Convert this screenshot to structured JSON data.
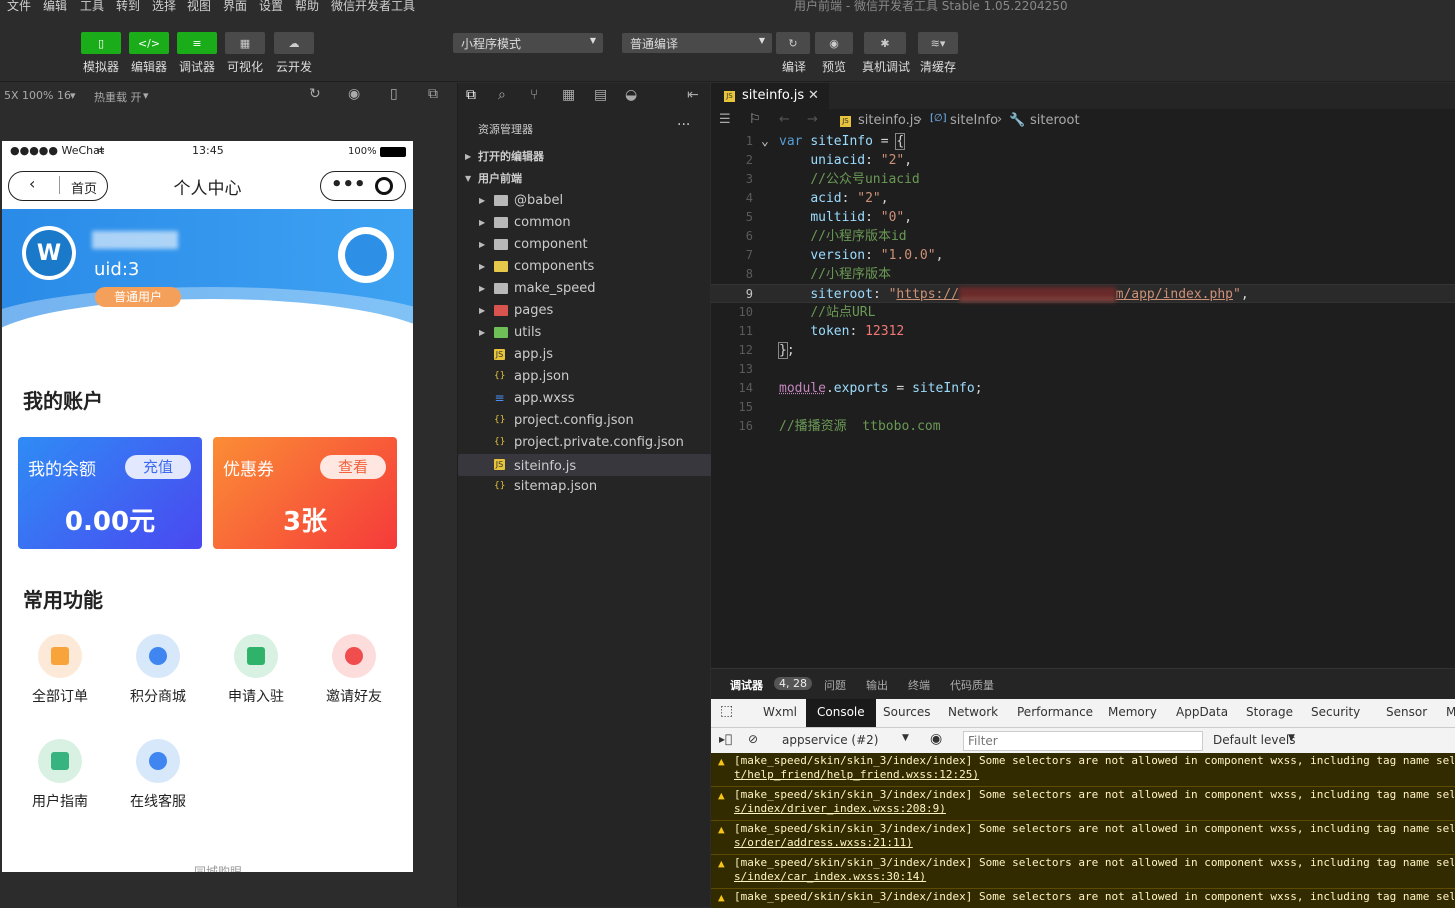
{
  "menu": [
    "文件",
    "编辑",
    "工具",
    "转到",
    "选择",
    "视图",
    "界面",
    "设置",
    "帮助",
    "微信开发者工具"
  ],
  "window_title": "用户前端 - 微信开发者工具 Stable 1.05.2204250",
  "toolbar": {
    "buttons": [
      "模拟器",
      "编辑器",
      "调试器",
      "可视化",
      "云开发"
    ],
    "mode_select": "小程序模式",
    "compile_select": "普通编译",
    "right_labels": [
      "编译",
      "预览",
      "真机调试",
      "清缓存"
    ]
  },
  "simulator_bar": {
    "zoom": "5X 100% 16",
    "hotreload": "热重载 开"
  },
  "phone": {
    "carrier": "●●●●● WeChat",
    "time": "13:45",
    "battery": "100%",
    "home_label": "首页",
    "page_title": "个人中心",
    "uid": "uid:3",
    "user_badge": "普通用户",
    "account_title": "我的账户",
    "balance_label": "我的余额",
    "recharge_btn": "充值",
    "balance_value": "0.00元",
    "coupon_label": "优惠券",
    "view_btn": "查看",
    "coupon_value": "3张",
    "functions_title": "常用功能",
    "functions": [
      "全部订单",
      "积分商城",
      "申请入驻",
      "邀请好友",
      "用户指南",
      "在线客服"
    ],
    "bottom_text": "同城购眼"
  },
  "explorer": {
    "title": "资源管理器",
    "more": "···",
    "open_editors": "打开的编辑器",
    "project": "用户前端",
    "items": [
      "@babel",
      "common",
      "component",
      "components",
      "make_speed",
      "pages",
      "utils",
      "app.js",
      "app.json",
      "app.wxss",
      "project.config.json",
      "project.private.config.json",
      "siteinfo.js",
      "sitemap.json"
    ]
  },
  "editor": {
    "tab": "siteinfo.js",
    "breadcrumb": [
      "siteinfo.js",
      "siteInfo",
      "siteroot"
    ],
    "line_numbers": [
      "1",
      "2",
      "3",
      "4",
      "5",
      "6",
      "7",
      "8",
      "9",
      "10",
      "11",
      "12",
      "13",
      "14",
      "15",
      "16"
    ]
  },
  "devtools": {
    "top_tabs": [
      "调试器",
      "4, 28",
      "问题",
      "输出",
      "终端",
      "代码质量"
    ],
    "tabs": [
      "Wxml",
      "Console",
      "Sources",
      "Network",
      "Performance",
      "Memory",
      "AppData",
      "Storage",
      "Security",
      "Sensor",
      "M"
    ],
    "context": "appservice (#2)",
    "filter_placeholder": "Filter",
    "levels": "Default levels",
    "logs": [
      {
        "msg": "[make_speed/skin/skin_3/index/index] Some selectors are not allowed in component wxss, including tag name sel",
        "src": "t/help_friend/help_friend.wxss:12:25)"
      },
      {
        "msg": "[make_speed/skin/skin_3/index/index] Some selectors are not allowed in component wxss, including tag name sel",
        "src": "s/index/driver_index.wxss:208:9)"
      },
      {
        "msg": "[make_speed/skin/skin_3/index/index] Some selectors are not allowed in component wxss, including tag name sel",
        "src": "s/order/address.wxss:21:11)"
      },
      {
        "msg": "[make_speed/skin/skin_3/index/index] Some selectors are not allowed in component wxss, including tag name sel",
        "src": "s/index/car_index.wxss:30:14)"
      },
      {
        "msg": "[make_speed/skin/skin_3/index/index] Some selectors are not allowed in component wxss, including tag name sel",
        "src": ""
      }
    ]
  }
}
